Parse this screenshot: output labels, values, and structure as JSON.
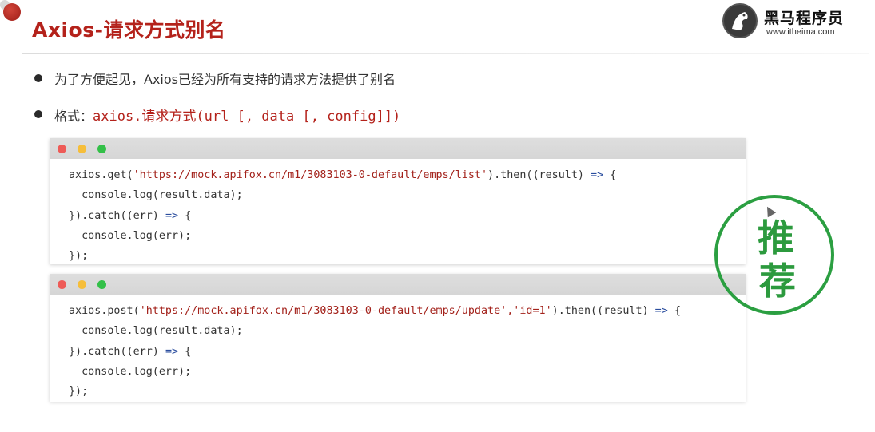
{
  "title": "Axios-请求方式别名",
  "logo": {
    "name": "黑马程序员",
    "url": "www.itheima.com"
  },
  "bullets": [
    {
      "text": "为了方便起见，Axios已经为所有支持的请求方法提供了别名"
    },
    {
      "label": "格式：",
      "code": "axios.请求方式(url [, data [, config]])"
    }
  ],
  "code_blocks": [
    {
      "lines": [
        {
          "pre": "axios.get(",
          "str": "'https://mock.apifox.cn/m1/3083103-0-default/emps/list'",
          "mid": ").then((result) ",
          "kw": "=>",
          "post": " {"
        },
        {
          "pre": "  console.log(result.data);"
        },
        {
          "pre": "}).catch((err) ",
          "kw": "=>",
          "post": " {"
        },
        {
          "pre": "  console.log(err);"
        },
        {
          "pre": "});"
        }
      ]
    },
    {
      "lines": [
        {
          "pre": "axios.post(",
          "str": "'https://mock.apifox.cn/m1/3083103-0-default/emps/update','id=1'",
          "mid": ").then((result) ",
          "kw": "=>",
          "post": " {"
        },
        {
          "pre": "  console.log(result.data);"
        },
        {
          "pre": "}).catch((err) ",
          "kw": "=>",
          "post": " {"
        },
        {
          "pre": "  console.log(err);"
        },
        {
          "pre": "});"
        }
      ]
    }
  ],
  "stamp": {
    "char1": "推",
    "char2": "荐",
    "color": "#2b9f41"
  },
  "colors": {
    "accent": "#b4221b",
    "keyword": "#2a4d9e"
  }
}
